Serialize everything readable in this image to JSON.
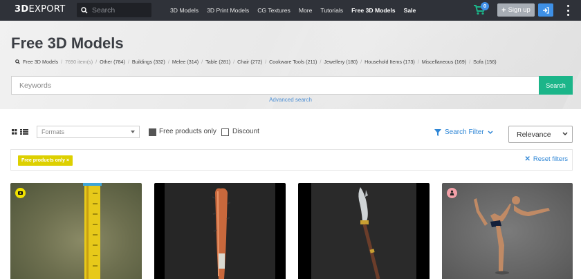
{
  "nav": {
    "logo_bold": "3D",
    "logo_rest": "EXPORT",
    "search_placeholder": "Search",
    "menu": [
      "3D Models",
      "3D Print Models",
      "CG Textures",
      "More",
      "Tutorials",
      "Free 3D Models",
      "Sale"
    ],
    "cart_count": "0",
    "signup_label": "Sign up",
    "icons": [
      "search-icon",
      "cart-icon",
      "plus-icon",
      "login-icon",
      "more-vert-icon"
    ]
  },
  "hero": {
    "title": "Free 3D Models",
    "breadcrumb_root": "Free 3D Models",
    "item_count": "7690 item(s)",
    "categories": [
      "Other (784)",
      "Buildings (332)",
      "Melee (314)",
      "Table (281)",
      "Chair (272)",
      "Cookware Tools (211)",
      "Jewellery (180)",
      "Household Items (173)",
      "Miscellaneous (169)",
      "Sofa (156)"
    ],
    "keywords_placeholder": "Keywords",
    "search_button": "Search",
    "advanced_search": "Advanced search"
  },
  "toolbar": {
    "formats_placeholder": "Formats",
    "free_only_label": "Free products only",
    "free_only_checked": true,
    "discount_label": "Discount",
    "discount_checked": false,
    "search_filter_label": "Search Filter",
    "sort_selected": "Relevance"
  },
  "filters": {
    "active_tag": "Free products only ×",
    "reset_label": "Reset filters"
  },
  "products": [
    {
      "name": "ruler",
      "badge": "yellow"
    },
    {
      "name": "spiked-bat",
      "badge": "none"
    },
    {
      "name": "glaive",
      "badge": "none"
    },
    {
      "name": "yoga-man",
      "badge": "pink"
    }
  ],
  "colors": {
    "nav_bg": "#2f3239",
    "accent_green": "#1bb589",
    "accent_blue": "#2e86d6",
    "tag_yellow": "#ddd000"
  }
}
